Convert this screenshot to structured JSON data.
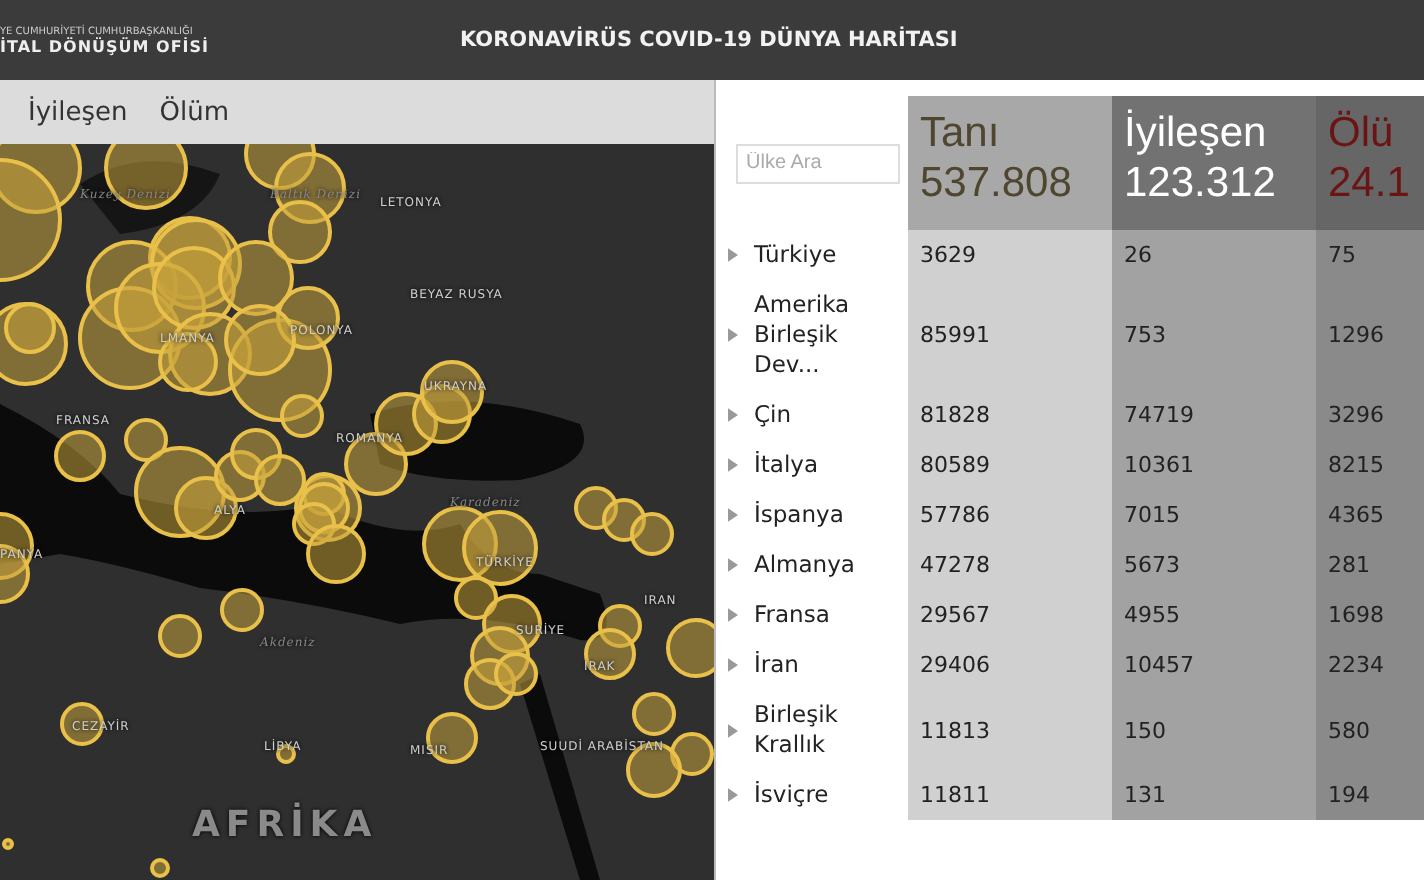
{
  "header": {
    "logo_small": "YE CUMHURİYETİ CUMHURBAŞKANLIĞI",
    "logo_main": "İTAL DÖNÜŞÜM OFİSİ",
    "title": "KORONAVİRÜS COVID-19 DÜNYA HARİTASI"
  },
  "map_tabs": [
    {
      "label": "İyileşen"
    },
    {
      "label": "Ölüm"
    }
  ],
  "map_labels": [
    {
      "text": "Kuzey Denizi",
      "kind": "sea"
    },
    {
      "text": "Baltık Denizi",
      "kind": "sea"
    },
    {
      "text": "LETONYA",
      "kind": "country"
    },
    {
      "text": "BEYAZ RUSYA",
      "kind": "country"
    },
    {
      "text": "POLONYA",
      "kind": "country"
    },
    {
      "text": "LMANYA",
      "kind": "country"
    },
    {
      "text": "UKRAYNA",
      "kind": "country"
    },
    {
      "text": "FRANSA",
      "kind": "country"
    },
    {
      "text": "ROMANYA",
      "kind": "country"
    },
    {
      "text": "Karadeniz",
      "kind": "sea"
    },
    {
      "text": "ALYA",
      "kind": "country"
    },
    {
      "text": "PANYA",
      "kind": "country"
    },
    {
      "text": "TÜRKİYE",
      "kind": "country"
    },
    {
      "text": "IRAN",
      "kind": "country"
    },
    {
      "text": "SURİYE",
      "kind": "country"
    },
    {
      "text": "Akdeniz",
      "kind": "sea"
    },
    {
      "text": "IRAK",
      "kind": "country"
    },
    {
      "text": "CEZAYİR",
      "kind": "country"
    },
    {
      "text": "LİBYA",
      "kind": "country"
    },
    {
      "text": "MISIR",
      "kind": "country"
    },
    {
      "text": "SUUDİ ARABİSTAN",
      "kind": "country"
    },
    {
      "text": "AFRİKA",
      "kind": "continent"
    }
  ],
  "search": {
    "placeholder": "Ülke Ara"
  },
  "totals": [
    {
      "label": "Tanı",
      "value": "537.808",
      "kind": "cases"
    },
    {
      "label": "İyileşen",
      "value": "123.312",
      "kind": "recovered"
    },
    {
      "label": "Ölü",
      "value": "24.1",
      "kind": "deaths"
    }
  ],
  "rows": [
    {
      "country": "Türkiye",
      "values": [
        "3629",
        "26",
        "75"
      ]
    },
    {
      "country": "Amerika Birleşik Dev...",
      "values": [
        "85991",
        "753",
        "1296"
      ]
    },
    {
      "country": "Çin",
      "values": [
        "81828",
        "74719",
        "3296"
      ]
    },
    {
      "country": "İtalya",
      "values": [
        "80589",
        "10361",
        "8215"
      ]
    },
    {
      "country": "İspanya",
      "values": [
        "57786",
        "7015",
        "4365"
      ]
    },
    {
      "country": "Almanya",
      "values": [
        "47278",
        "5673",
        "281"
      ]
    },
    {
      "country": "Fransa",
      "values": [
        "29567",
        "4955",
        "1698"
      ]
    },
    {
      "country": "İran",
      "values": [
        "29406",
        "10457",
        "2234"
      ]
    },
    {
      "country": "Birleşik Krallık",
      "values": [
        "11813",
        "150",
        "580"
      ]
    },
    {
      "country": "İsviçre",
      "values": [
        "11811",
        "131",
        "194"
      ]
    }
  ]
}
